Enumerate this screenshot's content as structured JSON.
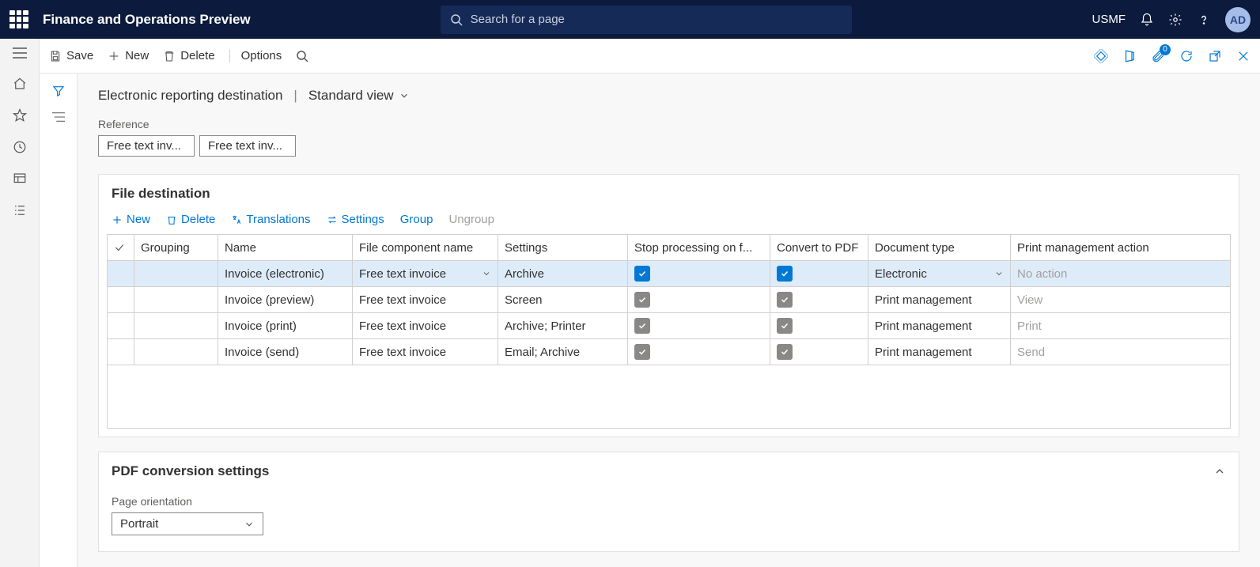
{
  "header": {
    "app_title": "Finance and Operations Preview",
    "search_placeholder": "Search for a page",
    "entity": "USMF",
    "avatar": "AD",
    "attach_badge": "0"
  },
  "actionbar": {
    "save": "Save",
    "new": "New",
    "delete": "Delete",
    "options": "Options"
  },
  "page": {
    "title": "Electronic reporting destination",
    "view": "Standard view"
  },
  "reference": {
    "label": "Reference",
    "values": [
      "Free text inv...",
      "Free text inv..."
    ]
  },
  "file_dest": {
    "title": "File destination",
    "toolbar": {
      "new": "New",
      "delete": "Delete",
      "translations": "Translations",
      "settings": "Settings",
      "group": "Group",
      "ungroup": "Ungroup"
    },
    "columns": {
      "grouping": "Grouping",
      "name": "Name",
      "component": "File component name",
      "settings": "Settings",
      "stop": "Stop processing on f...",
      "convert": "Convert to PDF",
      "doctype": "Document type",
      "pmaction": "Print management action"
    },
    "rows": [
      {
        "name": "Invoice (electronic)",
        "component": "Free text invoice",
        "settings": "Archive",
        "stop": true,
        "convert": true,
        "doctype": "Electronic",
        "pmaction": "No action",
        "selected": true,
        "muted_pm": true
      },
      {
        "name": "Invoice (preview)",
        "component": "Free text invoice",
        "settings": "Screen",
        "stop": true,
        "convert": true,
        "doctype": "Print management",
        "pmaction": "View",
        "selected": false,
        "muted_pm": true
      },
      {
        "name": "Invoice (print)",
        "component": "Free text invoice",
        "settings": "Archive; Printer",
        "stop": true,
        "convert": true,
        "doctype": "Print management",
        "pmaction": "Print",
        "selected": false,
        "muted_pm": true
      },
      {
        "name": "Invoice (send)",
        "component": "Free text invoice",
        "settings": "Email; Archive",
        "stop": true,
        "convert": true,
        "doctype": "Print management",
        "pmaction": "Send",
        "selected": false,
        "muted_pm": true
      }
    ]
  },
  "pdf": {
    "title": "PDF conversion settings",
    "orientation_label": "Page orientation",
    "orientation_value": "Portrait"
  }
}
